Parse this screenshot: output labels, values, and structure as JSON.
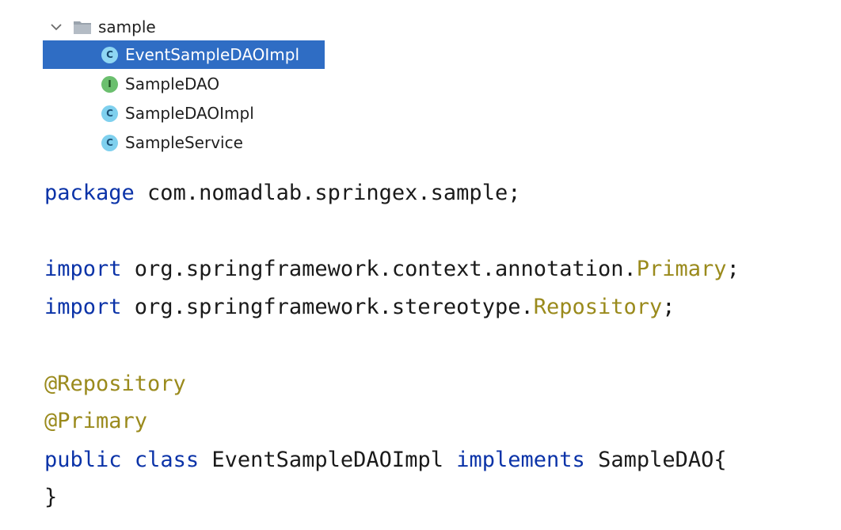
{
  "tree": {
    "folder": {
      "label": "sample",
      "icon": "folder-icon",
      "expand_icon": "chevron-down-icon"
    },
    "items": [
      {
        "label": "EventSampleDAOImpl",
        "icon_letter": "C",
        "kind": "class",
        "selected": true
      },
      {
        "label": "SampleDAO",
        "icon_letter": "I",
        "kind": "interface",
        "selected": false
      },
      {
        "label": "SampleDAOImpl",
        "icon_letter": "C",
        "kind": "class",
        "selected": false
      },
      {
        "label": "SampleService",
        "icon_letter": "C",
        "kind": "class",
        "selected": false
      }
    ]
  },
  "code": {
    "line1": {
      "kw": "package",
      "rest": " com.nomadlab.springex.sample;"
    },
    "line2": {
      "kw": "import",
      "pkg": " org.springframework.context.annotation.",
      "type": "Primary",
      "end": ";"
    },
    "line3": {
      "kw": "import",
      "pkg": " org.springframework.stereotype.",
      "type": "Repository",
      "end": ";"
    },
    "line4": {
      "annotation": "@Repository"
    },
    "line5": {
      "annotation": "@Primary"
    },
    "line6": {
      "kw1": "public",
      "kw2": "class",
      "name": "EventSampleDAOImpl",
      "kw3": "implements",
      "iface": "SampleDAO{"
    },
    "line7": {
      "brace": "}"
    }
  },
  "colors": {
    "selection": "#2f6dc4",
    "keyword": "#0b33a8",
    "annotation": "#9a8a1c",
    "class_icon": "#7fd0ee",
    "interface_icon": "#6bbf6e"
  }
}
